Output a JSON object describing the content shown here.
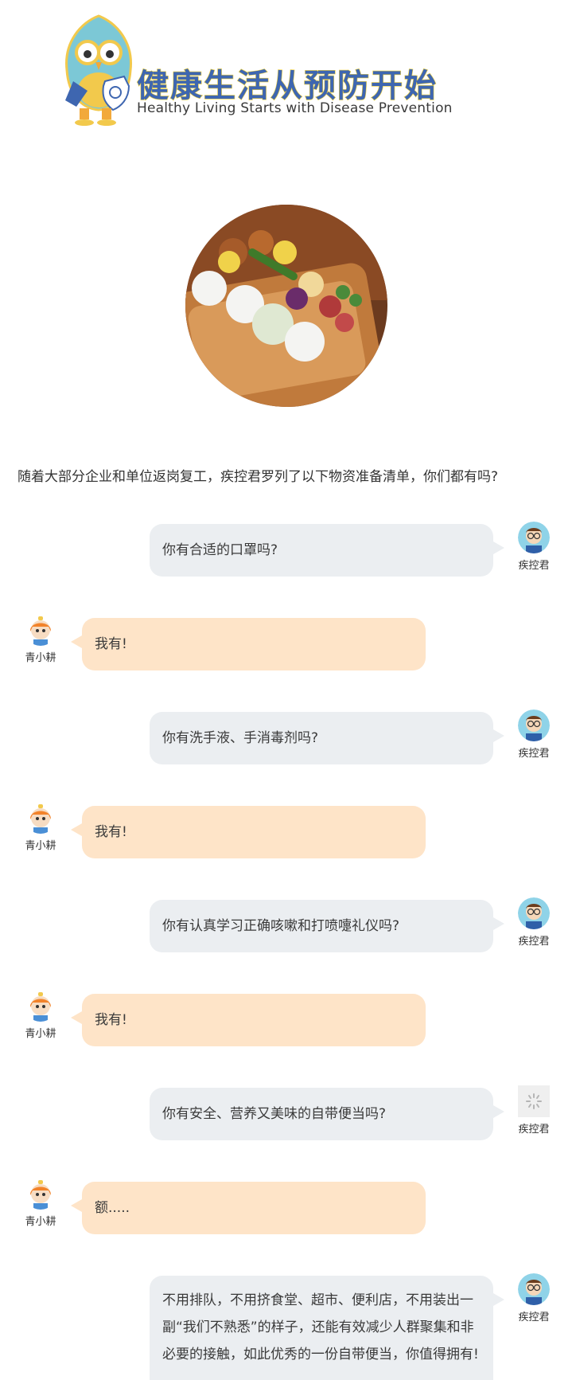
{
  "header": {
    "title_cn": "健康生活从预防开始",
    "title_en": "Healthy  Living Starts with Disease Prevention"
  },
  "intro": "随着大部分企业和单位返岗复工，疾控君罗列了以下物资准备清单，你们都有吗?",
  "speakers": {
    "cdc": "疾控君",
    "user": "青小耕"
  },
  "messages": [
    {
      "side": "right",
      "text": "你有合适的口罩吗?"
    },
    {
      "side": "left",
      "text": "我有!"
    },
    {
      "side": "right",
      "text": "你有洗手液、手消毒剂吗?"
    },
    {
      "side": "left",
      "text": "我有!"
    },
    {
      "side": "right",
      "text": "你有认真学习正确咳嗽和打喷嚏礼仪吗?"
    },
    {
      "side": "left",
      "text": "我有!"
    },
    {
      "side": "right",
      "text": "你有安全、营养又美味的自带便当吗?"
    },
    {
      "side": "left",
      "text": "额....."
    },
    {
      "side": "right",
      "text": "不用排队，不用挤食堂、超市、便利店，不用装出一副“我们不熟悉”的样子，还能有效减少人群聚集和非必要的接触，如此优秀的一份自带便当，你值得拥有!"
    }
  ],
  "colors": {
    "cdc_bubble": "#ebeef1",
    "user_bubble": "#fee4c8",
    "title_blue": "#3e66b0",
    "title_yellow": "#f3d23b"
  }
}
